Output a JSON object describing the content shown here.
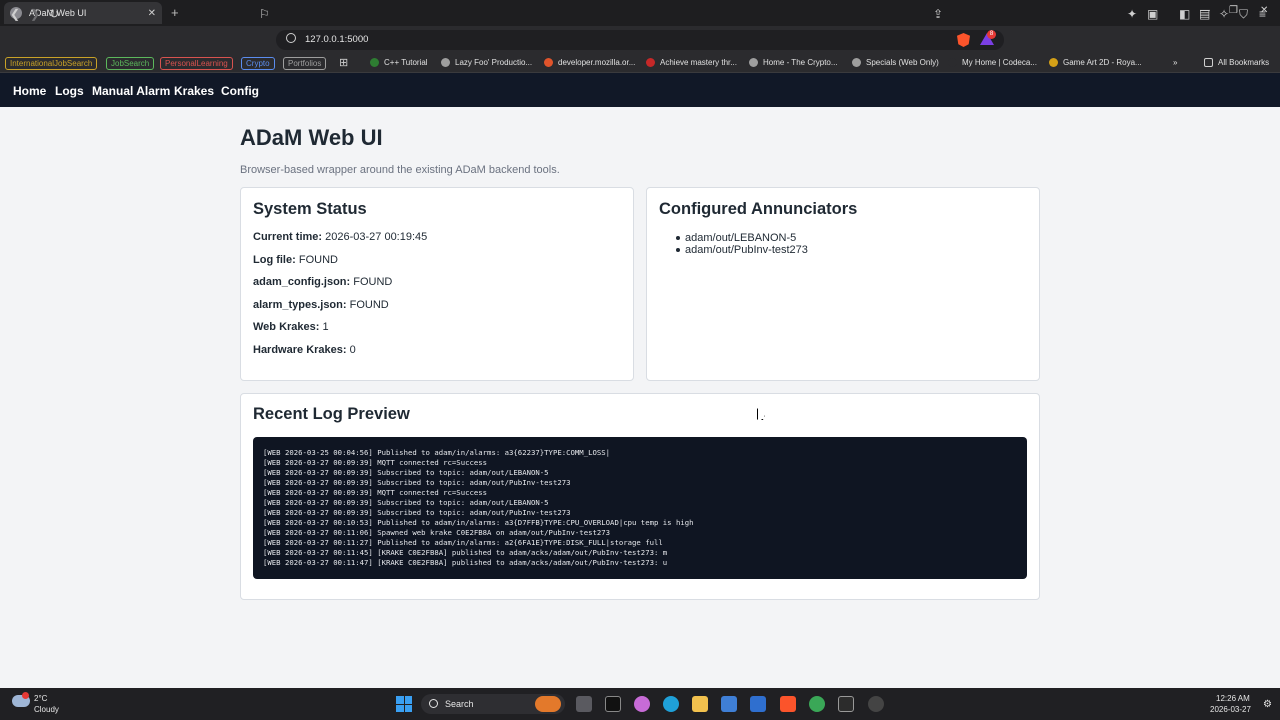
{
  "browser": {
    "tab_title": "ADaM Web UI",
    "url": "127.0.0.1:5000",
    "rewards_count": "8",
    "bookmark_tags": [
      {
        "label": "InternationalJobSearch",
        "color": "#c9a227"
      },
      {
        "label": "JobSearch",
        "color": "#5cb85c"
      },
      {
        "label": "PersonalLearning",
        "color": "#d9534f"
      },
      {
        "label": "Crypto",
        "color": "#5b8def"
      },
      {
        "label": "Portfolios",
        "color": "#9e9e9e"
      }
    ],
    "bookmarks": [
      {
        "label": "C++ Tutorial",
        "icon": "code-icon"
      },
      {
        "label": "Lazy Foo' Productio...",
        "icon": "globe-icon"
      },
      {
        "label": "developer.mozilla.or...",
        "icon": "mozilla-icon"
      },
      {
        "label": "Achieve mastery thr...",
        "icon": "site-icon"
      },
      {
        "label": "Home - The Crypto...",
        "icon": "site-icon"
      },
      {
        "label": "Specials (Web Only)",
        "icon": "globe-icon"
      },
      {
        "label": "My Home | Codeca...",
        "icon": "site-icon"
      },
      {
        "label": "Game Art 2D - Roya...",
        "icon": "site-icon"
      }
    ],
    "all_bookmarks": "All Bookmarks"
  },
  "nav": {
    "items": [
      "Home",
      "Logs",
      "Manual Alarm",
      "Krakes",
      "Config"
    ]
  },
  "page": {
    "title": "ADaM Web UI",
    "subtitle": "Browser-based wrapper around the existing ADaM backend tools."
  },
  "status": {
    "title": "System Status",
    "rows": [
      {
        "label": "Current time:",
        "value": "2026-03-27 00:19:45"
      },
      {
        "label": "Log file:",
        "value": "FOUND"
      },
      {
        "label": "adam_config.json:",
        "value": "FOUND"
      },
      {
        "label": "alarm_types.json:",
        "value": "FOUND"
      },
      {
        "label": "Web Krakes:",
        "value": "1"
      },
      {
        "label": "Hardware Krakes:",
        "value": "0"
      }
    ]
  },
  "annunciators": {
    "title": "Configured Annunciators",
    "items": [
      "adam/out/LEBANON-5",
      "adam/out/PubInv-test273"
    ]
  },
  "log": {
    "title": "Recent Log Preview",
    "lines": [
      "[WEB 2026-03-25 00:04:56] Published to adam/in/alarms: a3{62237}TYPE:COMM_LOSS|",
      "[WEB 2026-03-27 00:09:39] MQTT connected rc=Success",
      "[WEB 2026-03-27 00:09:39] Subscribed to topic: adam/out/LEBANON-5",
      "[WEB 2026-03-27 00:09:39] Subscribed to topic: adam/out/PubInv-test273",
      "[WEB 2026-03-27 00:09:39] MQTT connected rc=Success",
      "[WEB 2026-03-27 00:09:39] Subscribed to topic: adam/out/LEBANON-5",
      "[WEB 2026-03-27 00:09:39] Subscribed to topic: adam/out/PubInv-test273",
      "[WEB 2026-03-27 00:10:53] Published to adam/in/alarms: a3{D7FFB}TYPE:CPU_OVERLOAD|cpu temp is high",
      "[WEB 2026-03-27 00:11:06] Spawned web krake C0E2FB8A on adam/out/PubInv-test273",
      "[WEB 2026-03-27 00:11:27] Published to adam/in/alarms: a2{6FA1E}TYPE:DISK_FULL|storage full",
      "[WEB 2026-03-27 00:11:45] [KRAKE C0E2FB8A] published to adam/acks/adam/out/PubInv-test273: m",
      "[WEB 2026-03-27 00:11:47] [KRAKE C0E2FB8A] published to adam/acks/adam/out/PubInv-test273: u"
    ]
  },
  "taskbar": {
    "weather_temp": "2°C",
    "weather_condition": "Cloudy",
    "search_label": "Search",
    "time": "12:26 AM",
    "date": "2026-03-27"
  },
  "colors": {
    "nav_bg": "#111827",
    "log_bg": "#0f1522",
    "page_bg": "#f3f4f6"
  }
}
